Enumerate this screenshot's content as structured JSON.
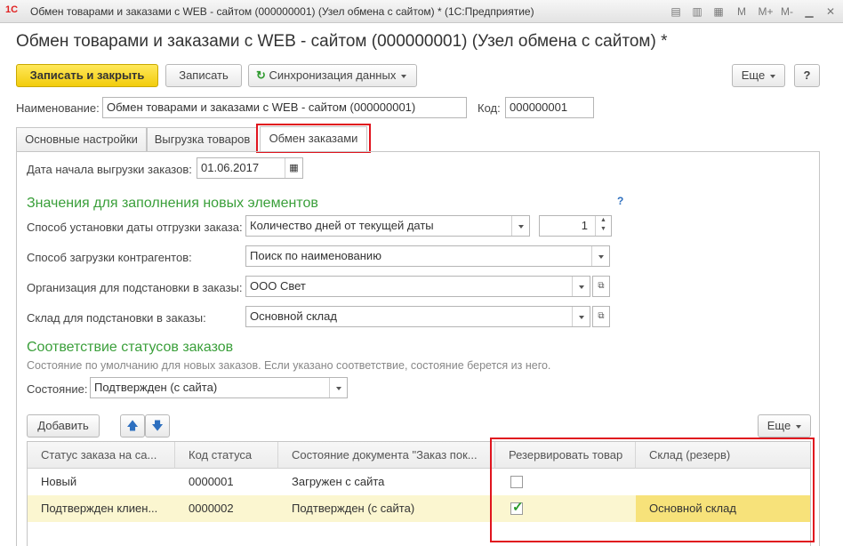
{
  "window": {
    "title": "Обмен товарами и заказами с WEB - сайтом (000000001) (Узел обмена с сайтом) * (1С:Предприятие)",
    "logo": "1С",
    "controls": [
      "M",
      "M+",
      "M-"
    ]
  },
  "form": {
    "heading": "Обмен товарами и заказами с WEB - сайтом (000000001) (Узел обмена с сайтом) *"
  },
  "toolbar": {
    "save_close": "Записать и закрыть",
    "save": "Записать",
    "sync": "Синхронизация данных",
    "more": "Еще",
    "help": "?"
  },
  "name_field": {
    "label": "Наименование:",
    "value": "Обмен товарами и заказами с WEB - сайтом (000000001)"
  },
  "code_field": {
    "label": "Код:",
    "value": "000000001"
  },
  "tabs": [
    {
      "label": "Основные настройки"
    },
    {
      "label": "Выгрузка товаров"
    },
    {
      "label": "Обмен заказами"
    }
  ],
  "orders": {
    "start_date_label": "Дата начала выгрузки заказов:",
    "start_date": "01.06.2017",
    "section_new": "Значения для заполнения новых элементов",
    "help": "?",
    "ship_date_label": "Способ установки даты отгрузки заказа:",
    "ship_date_value": "Количество дней от текущей даты",
    "ship_days": "1",
    "contractors_label": "Способ загрузки контрагентов:",
    "contractors_value": "Поиск по наименованию",
    "org_label": "Организация для подстановки в заказы:",
    "org_value": "ООО Свет",
    "warehouse_label": "Склад для подстановки в заказы:",
    "warehouse_value": "Основной склад",
    "section_status": "Соответствие статусов заказов",
    "status_note": "Состояние по умолчанию для новых заказов. Если указано соответствие, состояние берется из него.",
    "state_label": "Состояние:",
    "state_value": "Подтвержден (с сайта)"
  },
  "table_toolbar": {
    "add": "Добавить",
    "more": "Еще"
  },
  "table": {
    "headers": [
      "Статус заказа на са...",
      "Код статуса",
      "Состояние документа \"Заказ пок...",
      "Резервировать товар",
      "Склад (резерв)"
    ],
    "rows": [
      {
        "status": "Новый",
        "code": "0000001",
        "state": "Загружен с сайта",
        "reserve": false,
        "warehouse": ""
      },
      {
        "status": "Подтвержден клиен...",
        "code": "0000002",
        "state": "Подтвержден (с сайта)",
        "reserve": true,
        "warehouse": "Основной склад"
      }
    ]
  },
  "colors": {
    "accent_green": "#3a9f3a",
    "highlight_red": "#e0141e",
    "primary_yellow": "#f2cc0c",
    "selected_row": "#fbf6d0"
  }
}
